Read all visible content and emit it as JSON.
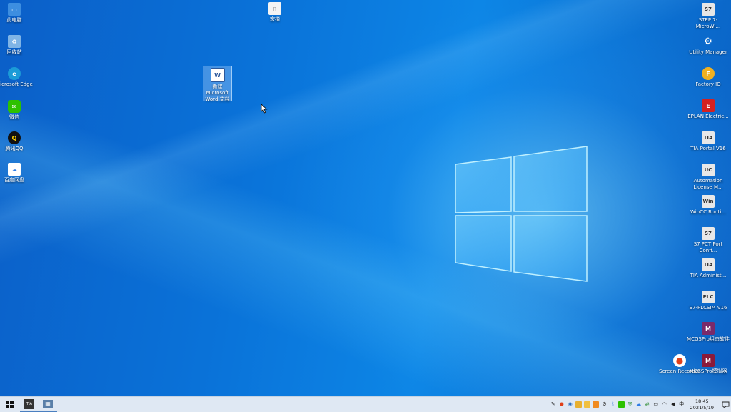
{
  "desktop": {
    "left_icons": [
      {
        "label": "此电脑",
        "glyph": "▭",
        "color": "#3d8ee0"
      },
      {
        "label": "回收站",
        "glyph": "♻",
        "color": "#7fb4e6"
      },
      {
        "label": "Microsoft Edge",
        "glyph": "e",
        "color": "#1b9bd7"
      },
      {
        "label": "微信",
        "glyph": "✉",
        "color": "#2dc100"
      },
      {
        "label": "腾讯QQ",
        "glyph": "Q",
        "color": "#111111"
      },
      {
        "label": "百度网盘",
        "glyph": "☁",
        "color": "#2f7ce6"
      }
    ],
    "top_icon": {
      "label": "宏楷",
      "glyph": "▯",
      "color": "#f2f2f2"
    },
    "word_doc": {
      "label": "新建 Microsoft Word 文档",
      "glyph": "W",
      "color": "#2b579a"
    },
    "right_icons": [
      {
        "label": "STEP 7-MicroWI...",
        "glyph": "S7",
        "color": "#4a4a4a"
      },
      {
        "label": "Utility Manager",
        "glyph": "⚙",
        "color": "#3a3a3a"
      },
      {
        "label": "Factory IO",
        "glyph": "F",
        "color": "#f0b020"
      },
      {
        "label": "EPLAN Electric...",
        "glyph": "E",
        "color": "#d42020"
      },
      {
        "label": "TIA Portal V16",
        "glyph": "TIA",
        "color": "#555555"
      },
      {
        "label": "Automation License M...",
        "glyph": "UC",
        "color": "#444444"
      },
      {
        "label": "WinCC Runti...",
        "glyph": "Win",
        "color": "#555555"
      },
      {
        "label": "S7 PCT Port Confi...",
        "glyph": "S7",
        "color": "#4a4a4a"
      },
      {
        "label": "TIA Administ...",
        "glyph": "TIA",
        "color": "#555555"
      },
      {
        "label": "S7-PLCSIM V16",
        "glyph": "PLC",
        "color": "#4a4a4a"
      },
      {
        "label": "MCGSPro组态软件",
        "glyph": "M",
        "color": "#7a2a6a"
      },
      {
        "label": "MCGSPro模拟器",
        "glyph": "M",
        "color": "#8a1a3a"
      }
    ],
    "screen_recorder": {
      "label": "Screen Recorder",
      "glyph": "●",
      "color": "#e0401a"
    }
  },
  "taskbar": {
    "apps": [
      {
        "name": "TIA Portal",
        "glyph": "TIA"
      },
      {
        "name": "Window",
        "glyph": "▦"
      }
    ],
    "clock_time": "18:45",
    "clock_date": "2021/5/19"
  }
}
